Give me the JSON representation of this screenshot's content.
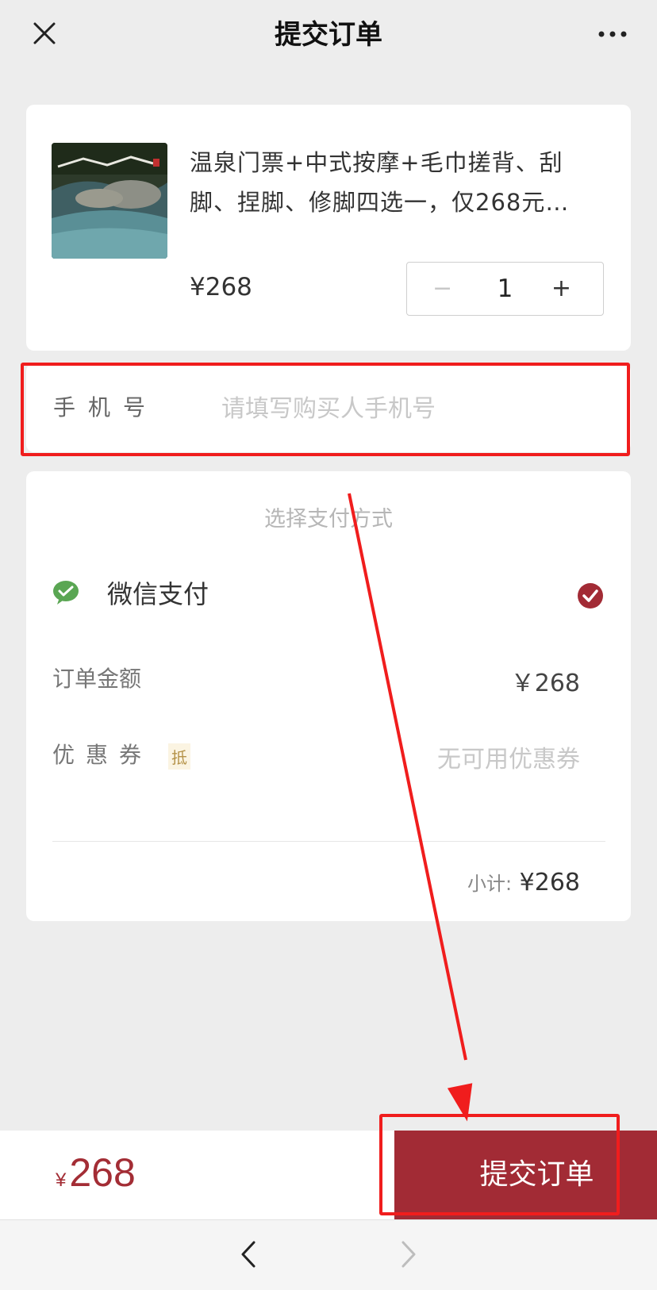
{
  "header": {
    "title": "提交订单",
    "close_icon": "close-icon",
    "more_icon": "more-dots-icon"
  },
  "product": {
    "title": "温泉门票+中式按摩+毛巾搓背、刮脚、捏脚、修脚四选一，仅268元…",
    "price": "¥268",
    "quantity": "1",
    "minus_label": "−",
    "plus_label": "+",
    "thumbnail_icon": "hot-spring-photo"
  },
  "phone": {
    "label": "手机号",
    "placeholder": "请填写购买人手机号",
    "value": ""
  },
  "payment": {
    "heading": "选择支付方式",
    "method": "微信支付",
    "method_icon": "wechat-pay-icon",
    "selected": true,
    "order_amount_label": "订单金额",
    "order_amount_value": "￥268",
    "coupon_label": "优惠券",
    "coupon_tag": "抵",
    "coupon_value": "无可用优惠券",
    "subtotal_label": "小计:",
    "subtotal_value": "¥268"
  },
  "footer": {
    "currency": "¥",
    "total": "268",
    "submit_label": "提交订单"
  },
  "navbar": {
    "back_icon": "chevron-left-icon",
    "forward_icon": "chevron-right-icon"
  },
  "colors": {
    "accent": "#a22b35",
    "highlight": "#f01d1d",
    "wechat_green": "#5aa653"
  }
}
